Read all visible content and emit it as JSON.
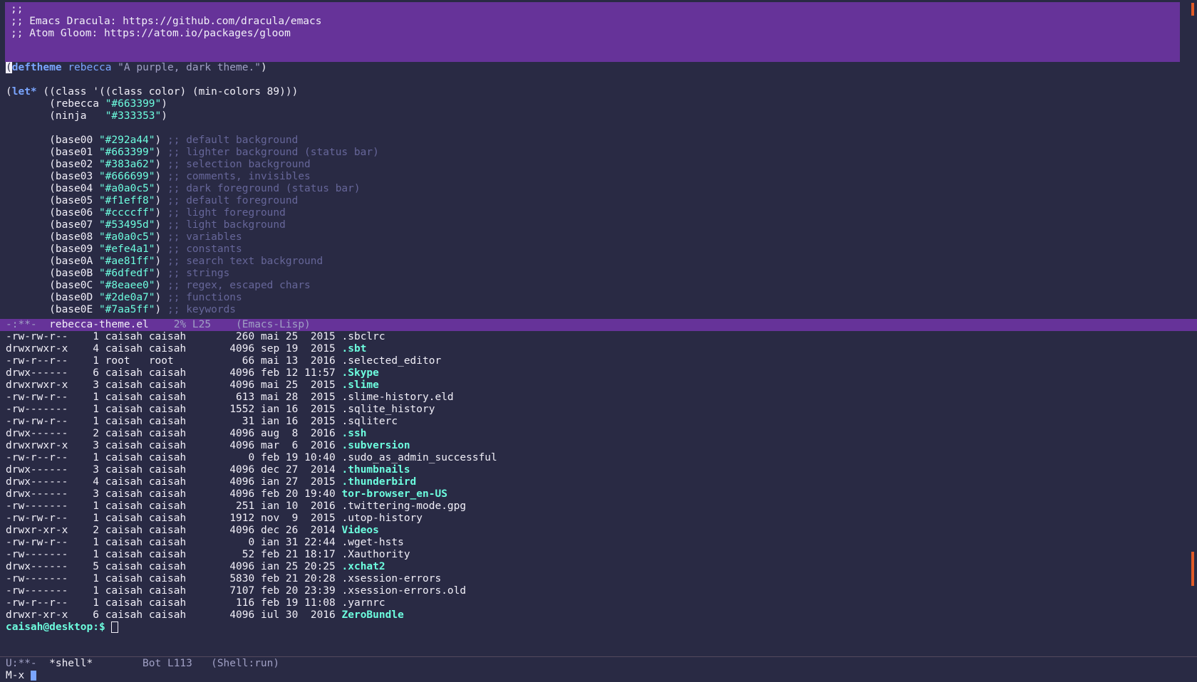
{
  "editor": {
    "header_lines": [
      ";;",
      ";; Emacs Dracula: https://github.com/dracula/emacs",
      ";; Atom Gloom: https://atom.io/packages/gloom"
    ],
    "deftheme": {
      "open": "(",
      "kw": "deftheme",
      "name": "rebecca",
      "doc": "\"A purple, dark theme.\"",
      "close": ")"
    },
    "let_line": {
      "open": "(",
      "kw": "let*",
      "rest": " ((class '((class color) (min-colors 89)))"
    },
    "bindings_top": [
      {
        "name": "(rebecca ",
        "value": "\"#663399\"",
        "close": ")"
      },
      {
        "name": "(ninja   ",
        "value": "\"#333353\"",
        "close": ")"
      }
    ],
    "bases": [
      {
        "name": "(base00 ",
        "value": "\"#292a44\"",
        "comment": ";; default background"
      },
      {
        "name": "(base01 ",
        "value": "\"#663399\"",
        "comment": ";; lighter background (status bar)"
      },
      {
        "name": "(base02 ",
        "value": "\"#383a62\"",
        "comment": ";; selection background"
      },
      {
        "name": "(base03 ",
        "value": "\"#666699\"",
        "comment": ";; comments, invisibles"
      },
      {
        "name": "(base04 ",
        "value": "\"#a0a0c5\"",
        "comment": ";; dark foreground (status bar)"
      },
      {
        "name": "(base05 ",
        "value": "\"#f1eff8\"",
        "comment": ";; default foreground"
      },
      {
        "name": "(base06 ",
        "value": "\"#ccccff\"",
        "comment": ";; light foreground"
      },
      {
        "name": "(base07 ",
        "value": "\"#53495d\"",
        "comment": ";; light background"
      },
      {
        "name": "(base08 ",
        "value": "\"#a0a0c5\"",
        "comment": ";; variables"
      },
      {
        "name": "(base09 ",
        "value": "\"#efe4a1\"",
        "comment": ";; constants"
      },
      {
        "name": "(base0A ",
        "value": "\"#ae81ff\"",
        "comment": ";; search text background"
      },
      {
        "name": "(base0B ",
        "value": "\"#6dfedf\"",
        "comment": ";; strings"
      },
      {
        "name": "(base0C ",
        "value": "\"#8eaee0\"",
        "comment": ";; regex, escaped chars"
      },
      {
        "name": "(base0D ",
        "value": "\"#2de0a7\"",
        "comment": ";; functions"
      },
      {
        "name": "(base0E ",
        "value": "\"#7aa5ff\"",
        "comment": ";; keywords"
      }
    ],
    "modeline": {
      "status": "-:**-  ",
      "buffer": "rebecca-theme.el",
      "position": "    2% L25    ",
      "mode": "(Emacs-Lisp)"
    }
  },
  "shell": {
    "rows": [
      {
        "perms": "-rw-rw-r--",
        "links": "1",
        "owner": "caisah",
        "group": "caisah",
        "size": "260",
        "month": "mai",
        "day": "25",
        "time": "2015",
        "name": ".sbclrc",
        "is_dir": false
      },
      {
        "perms": "drwxrwxr-x",
        "links": "4",
        "owner": "caisah",
        "group": "caisah",
        "size": "4096",
        "month": "sep",
        "day": "19",
        "time": "2015",
        "name": ".sbt",
        "is_dir": true
      },
      {
        "perms": "-rw-r--r--",
        "links": "1",
        "owner": "root",
        "group": "root",
        "size": "66",
        "month": "mai",
        "day": "13",
        "time": "2016",
        "name": ".selected_editor",
        "is_dir": false
      },
      {
        "perms": "drwx------",
        "links": "6",
        "owner": "caisah",
        "group": "caisah",
        "size": "4096",
        "month": "feb",
        "day": "12",
        "time": "11:57",
        "name": ".Skype",
        "is_dir": true
      },
      {
        "perms": "drwxrwxr-x",
        "links": "3",
        "owner": "caisah",
        "group": "caisah",
        "size": "4096",
        "month": "mai",
        "day": "25",
        "time": "2015",
        "name": ".slime",
        "is_dir": true
      },
      {
        "perms": "-rw-rw-r--",
        "links": "1",
        "owner": "caisah",
        "group": "caisah",
        "size": "613",
        "month": "mai",
        "day": "28",
        "time": "2015",
        "name": ".slime-history.eld",
        "is_dir": false
      },
      {
        "perms": "-rw-------",
        "links": "1",
        "owner": "caisah",
        "group": "caisah",
        "size": "1552",
        "month": "ian",
        "day": "16",
        "time": "2015",
        "name": ".sqlite_history",
        "is_dir": false
      },
      {
        "perms": "-rw-rw-r--",
        "links": "1",
        "owner": "caisah",
        "group": "caisah",
        "size": "31",
        "month": "ian",
        "day": "16",
        "time": "2015",
        "name": ".sqliterc",
        "is_dir": false
      },
      {
        "perms": "drwx------",
        "links": "2",
        "owner": "caisah",
        "group": "caisah",
        "size": "4096",
        "month": "aug",
        "day": "8",
        "time": "2016",
        "name": ".ssh",
        "is_dir": true
      },
      {
        "perms": "drwxrwxr-x",
        "links": "3",
        "owner": "caisah",
        "group": "caisah",
        "size": "4096",
        "month": "mar",
        "day": "6",
        "time": "2016",
        "name": ".subversion",
        "is_dir": true
      },
      {
        "perms": "-rw-r--r--",
        "links": "1",
        "owner": "caisah",
        "group": "caisah",
        "size": "0",
        "month": "feb",
        "day": "19",
        "time": "10:40",
        "name": ".sudo_as_admin_successful",
        "is_dir": false
      },
      {
        "perms": "drwx------",
        "links": "3",
        "owner": "caisah",
        "group": "caisah",
        "size": "4096",
        "month": "dec",
        "day": "27",
        "time": "2014",
        "name": ".thumbnails",
        "is_dir": true
      },
      {
        "perms": "drwx------",
        "links": "4",
        "owner": "caisah",
        "group": "caisah",
        "size": "4096",
        "month": "ian",
        "day": "27",
        "time": "2015",
        "name": ".thunderbird",
        "is_dir": true
      },
      {
        "perms": "drwx------",
        "links": "3",
        "owner": "caisah",
        "group": "caisah",
        "size": "4096",
        "month": "feb",
        "day": "20",
        "time": "19:40",
        "name": "tor-browser_en-US",
        "is_dir": true
      },
      {
        "perms": "-rw-------",
        "links": "1",
        "owner": "caisah",
        "group": "caisah",
        "size": "251",
        "month": "ian",
        "day": "10",
        "time": "2016",
        "name": ".twittering-mode.gpg",
        "is_dir": false
      },
      {
        "perms": "-rw-rw-r--",
        "links": "1",
        "owner": "caisah",
        "group": "caisah",
        "size": "1912",
        "month": "nov",
        "day": "9",
        "time": "2015",
        "name": ".utop-history",
        "is_dir": false
      },
      {
        "perms": "drwxr-xr-x",
        "links": "2",
        "owner": "caisah",
        "group": "caisah",
        "size": "4096",
        "month": "dec",
        "day": "26",
        "time": "2014",
        "name": "Videos",
        "is_dir": true
      },
      {
        "perms": "-rw-rw-r--",
        "links": "1",
        "owner": "caisah",
        "group": "caisah",
        "size": "0",
        "month": "ian",
        "day": "31",
        "time": "22:44",
        "name": ".wget-hsts",
        "is_dir": false
      },
      {
        "perms": "-rw-------",
        "links": "1",
        "owner": "caisah",
        "group": "caisah",
        "size": "52",
        "month": "feb",
        "day": "21",
        "time": "18:17",
        "name": ".Xauthority",
        "is_dir": false
      },
      {
        "perms": "drwx------",
        "links": "5",
        "owner": "caisah",
        "group": "caisah",
        "size": "4096",
        "month": "ian",
        "day": "25",
        "time": "20:25",
        "name": ".xchat2",
        "is_dir": true
      },
      {
        "perms": "-rw-------",
        "links": "1",
        "owner": "caisah",
        "group": "caisah",
        "size": "5830",
        "month": "feb",
        "day": "21",
        "time": "20:28",
        "name": ".xsession-errors",
        "is_dir": false
      },
      {
        "perms": "-rw-------",
        "links": "1",
        "owner": "caisah",
        "group": "caisah",
        "size": "7107",
        "month": "feb",
        "day": "20",
        "time": "23:39",
        "name": ".xsession-errors.old",
        "is_dir": false
      },
      {
        "perms": "-rw-r--r--",
        "links": "1",
        "owner": "caisah",
        "group": "caisah",
        "size": "116",
        "month": "feb",
        "day": "19",
        "time": "11:08",
        "name": ".yarnrc",
        "is_dir": false
      },
      {
        "perms": "drwxr-xr-x",
        "links": "6",
        "owner": "caisah",
        "group": "caisah",
        "size": "4096",
        "month": "iul",
        "day": "30",
        "time": "2016",
        "name": "ZeroBundle",
        "is_dir": true
      }
    ],
    "prompt": "caisah@desktop:$",
    "modeline": {
      "status": "U:**-  ",
      "buffer": "*shell*",
      "position": "        Bot L113   ",
      "mode": "(Shell:run)"
    }
  },
  "minibuffer": {
    "text": "M-x "
  },
  "colors": {
    "background": "#292a44",
    "accent": "#663399",
    "keyword": "#7aa5ff",
    "string": "#6dfedf",
    "comment": "#666699",
    "scroll_marker": "#e05a28"
  }
}
